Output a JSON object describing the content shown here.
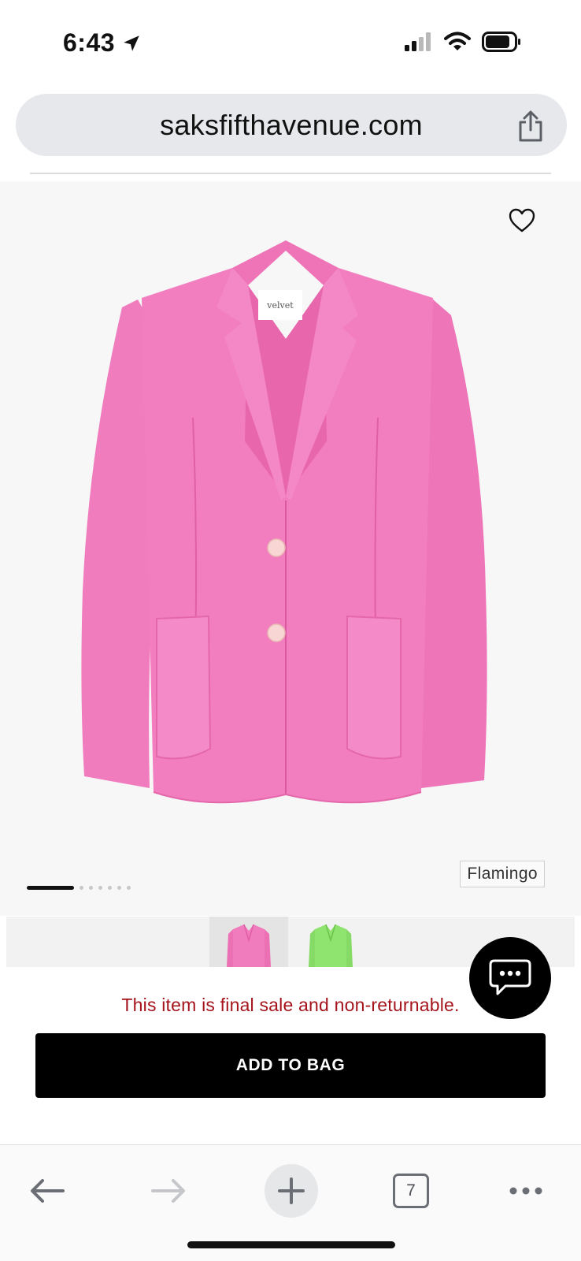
{
  "status_bar": {
    "time": "6:43",
    "icons": [
      "location-arrow-icon",
      "cellular-signal-icon",
      "wifi-icon",
      "battery-icon"
    ]
  },
  "browser": {
    "url": "saksfifthavenue.com",
    "share_icon": "share-icon",
    "toolbar": {
      "back_icon": "arrow-left-icon",
      "forward_icon": "arrow-right-icon",
      "new_tab_icon": "plus-icon",
      "tab_count": "7",
      "more_icon": "ellipsis-icon"
    }
  },
  "product": {
    "color_name": "Flamingo",
    "image_label": "velvet",
    "gallery_pages": 7,
    "active_page": 1,
    "thumbnails": [
      {
        "color": "#f07bbd",
        "label": "Flamingo"
      },
      {
        "color": "#8fe36f",
        "label": "green"
      }
    ],
    "final_sale_notice": "This item is final sale and non-returnable.",
    "add_to_bag_label": "ADD TO BAG"
  },
  "colors": {
    "accent_red": "#a5141c",
    "button_black": "#000000",
    "jacket_pink": "#f07bbd",
    "url_bar_bg": "#e6e8eb"
  }
}
